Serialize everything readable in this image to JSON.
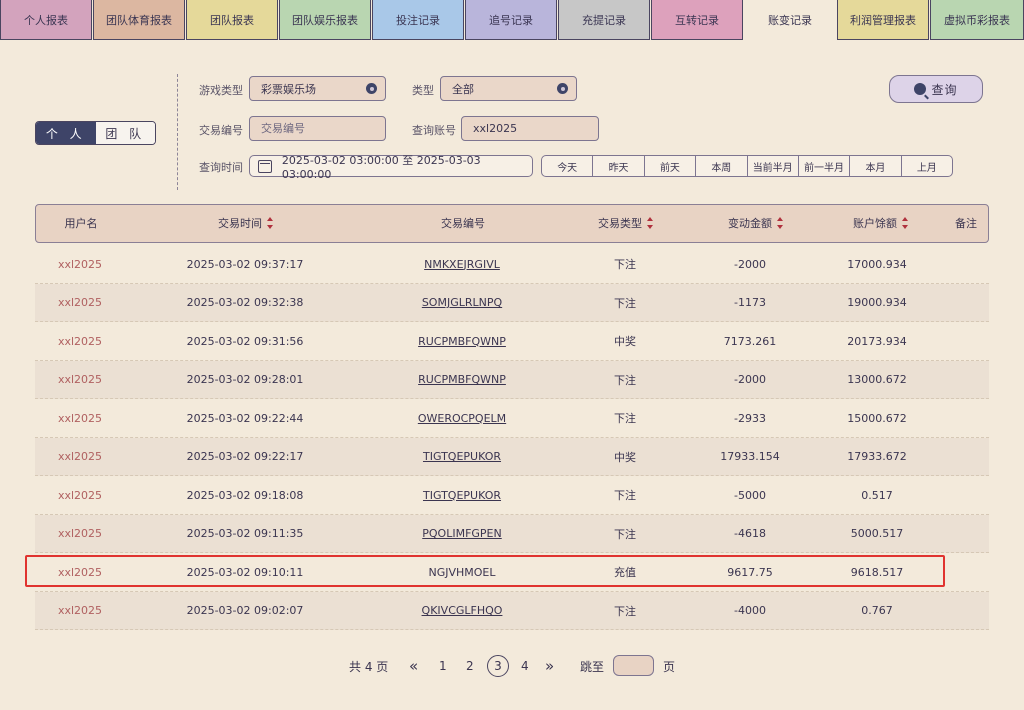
{
  "tabs": [
    {
      "label": "个人报表",
      "color": "#d3a3bd"
    },
    {
      "label": "团队体育报表",
      "color": "#dcb7a1"
    },
    {
      "label": "团队报表",
      "color": "#e5d99a"
    },
    {
      "label": "团队娱乐报表",
      "color": "#b9d6b1"
    },
    {
      "label": "投注记录",
      "color": "#a9c8e8"
    },
    {
      "label": "追号记录",
      "color": "#b9b5db"
    },
    {
      "label": "充提记录",
      "color": "#c7c7c7"
    },
    {
      "label": "互转记录",
      "color": "#dda1bc"
    },
    {
      "label": "账变记录",
      "color": "#f3eadb"
    },
    {
      "label": "利润管理报表",
      "color": "#e5d99a"
    },
    {
      "label": "虚拟币彩报表",
      "color": "#b9d6b1"
    }
  ],
  "mode": {
    "personal": "个 人",
    "team": "团 队"
  },
  "filters": {
    "game_type_label": "游戏类型",
    "game_type_value": "彩票娱乐场",
    "type_label": "类型",
    "type_value": "全部",
    "tx_no_label": "交易编号",
    "tx_no_placeholder": "交易编号",
    "account_label": "查询账号",
    "account_value": "xxl2025",
    "time_label": "查询时间",
    "time_range": "2025-03-02 03:00:00 至 2025-03-03 03:00:00",
    "quick_ranges": [
      "今天",
      "昨天",
      "前天",
      "本周",
      "当前半月",
      "前一半月",
      "本月",
      "上月"
    ],
    "query_button": "查询"
  },
  "table": {
    "headers": [
      "用户名",
      "交易时间",
      "交易编号",
      "交易类型",
      "变动金额",
      "账户馀额",
      "备注"
    ],
    "rows": [
      {
        "user": "xxl2025",
        "time": "2025-03-02 09:37:17",
        "txid": "NMKXEJRGIVL",
        "type": "下注",
        "amount": "-2000",
        "balance": "17000.934",
        "note": ""
      },
      {
        "user": "xxl2025",
        "time": "2025-03-02 09:32:38",
        "txid": "SOMJGLRLNPQ",
        "type": "下注",
        "amount": "-1173",
        "balance": "19000.934",
        "note": ""
      },
      {
        "user": "xxl2025",
        "time": "2025-03-02 09:31:56",
        "txid": "RUCPMBFQWNP",
        "type": "中奖",
        "amount": "7173.261",
        "balance": "20173.934",
        "note": ""
      },
      {
        "user": "xxl2025",
        "time": "2025-03-02 09:28:01",
        "txid": "RUCPMBFQWNP",
        "type": "下注",
        "amount": "-2000",
        "balance": "13000.672",
        "note": ""
      },
      {
        "user": "xxl2025",
        "time": "2025-03-02 09:22:44",
        "txid": "OWEROCPQELM",
        "type": "下注",
        "amount": "-2933",
        "balance": "15000.672",
        "note": ""
      },
      {
        "user": "xxl2025",
        "time": "2025-03-02 09:22:17",
        "txid": "TIGTQEPUKOR",
        "type": "中奖",
        "amount": "17933.154",
        "balance": "17933.672",
        "note": ""
      },
      {
        "user": "xxl2025",
        "time": "2025-03-02 09:18:08",
        "txid": "TIGTQEPUKOR",
        "type": "下注",
        "amount": "-5000",
        "balance": "0.517",
        "note": ""
      },
      {
        "user": "xxl2025",
        "time": "2025-03-02 09:11:35",
        "txid": "PQOLIMFGPEN",
        "type": "下注",
        "amount": "-4618",
        "balance": "5000.517",
        "note": ""
      },
      {
        "user": "xxl2025",
        "time": "2025-03-02 09:10:11",
        "txid": "NGJVHMOEL",
        "type": "充值",
        "amount": "9617.75",
        "balance": "9618.517",
        "note": ""
      },
      {
        "user": "xxl2025",
        "time": "2025-03-02 09:02:07",
        "txid": "QKIVCGLFHQO",
        "type": "下注",
        "amount": "-4000",
        "balance": "0.767",
        "note": ""
      }
    ]
  },
  "pager": {
    "total": "共 4 页",
    "first": "«",
    "pages": [
      "1",
      "2",
      "3",
      "4"
    ],
    "current": "3",
    "last": "»",
    "jump_label": "跳至",
    "page_unit": "页"
  },
  "colors": {
    "accent": "#3e4468",
    "highlight": "#e0332f",
    "username": "#b06060"
  }
}
